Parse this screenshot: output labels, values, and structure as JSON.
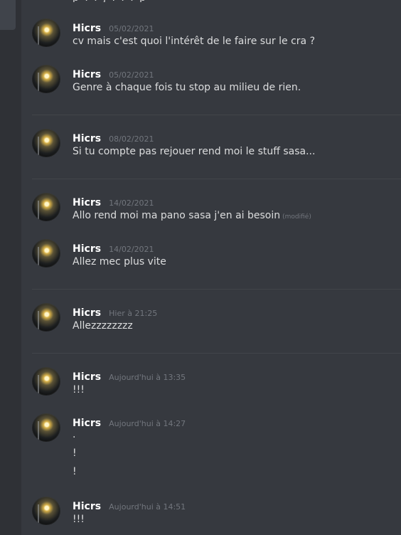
{
  "messages": [
    {
      "user": "Hicrs",
      "time": "05/02/2021",
      "lines": [
        "cv mais c'est quoi l'intérêt de le faire sur le cra ?"
      ]
    },
    {
      "user": "Hicrs",
      "time": "05/02/2021",
      "lines": [
        "Genre à chaque fois tu stop au milieu de rien."
      ]
    },
    {
      "user": "Hicrs",
      "time": "08/02/2021",
      "lines": [
        "Si tu compte pas rejouer rend moi le stuff sasa..."
      ]
    },
    {
      "user": "Hicrs",
      "time": "14/02/2021",
      "lines": [
        "Allo rend moi ma pano sasa j'en ai besoin"
      ],
      "edited": "(modifié)"
    },
    {
      "user": "Hicrs",
      "time": "14/02/2021",
      "lines": [
        "Allez mec plus vite"
      ]
    },
    {
      "user": "Hicrs",
      "time": "Hier à 21:25",
      "lines": [
        "Allezzzzzzzz"
      ]
    },
    {
      "user": "Hicrs",
      "time": "Aujourd'hui à 13:35",
      "lines": [
        "!!!"
      ]
    },
    {
      "user": "Hicrs",
      "time": "Aujourd'hui à 14:27",
      "lines": [
        ".",
        "!",
        "!"
      ]
    },
    {
      "user": "Hicrs",
      "time": "Aujourd'hui à 14:51",
      "lines": [
        "!!!"
      ]
    }
  ]
}
